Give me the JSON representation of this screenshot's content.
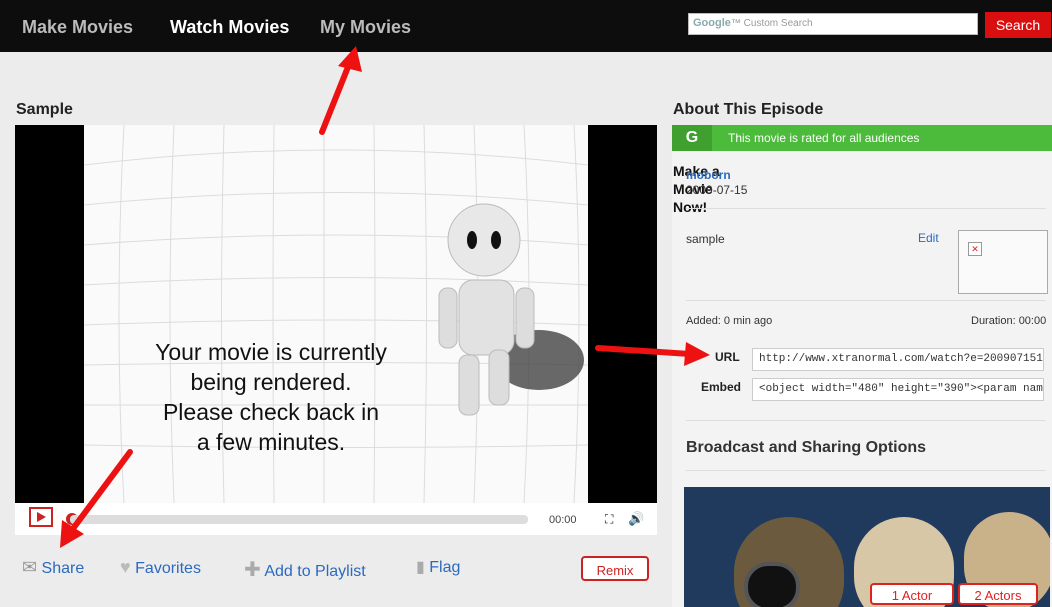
{
  "nav": {
    "items": [
      {
        "label": "Make Movies",
        "color": "#bbbbbb"
      },
      {
        "label": "Watch Movies",
        "color": "#ffffff"
      },
      {
        "label": "My Movies",
        "color": "#bbbbbb"
      }
    ]
  },
  "search": {
    "brand": "Google",
    "placeholder": "Custom Search",
    "button": "Search"
  },
  "video": {
    "title": "Sample",
    "message": [
      "Your movie is currently",
      "being rendered.",
      "Please check back in",
      "a few minutes."
    ],
    "time": "00:00"
  },
  "actions": {
    "share": "Share",
    "favorites": "Favorites",
    "playlist": "Add to Playlist",
    "flag": "Flag",
    "remix": "Remix"
  },
  "episode": {
    "heading": "About This Episode",
    "rating_letter": "G",
    "rating_text": "This movie is rated for all audiences",
    "overlay": "Make a Movie Now!",
    "author": "moborn",
    "date": "2009-07-15",
    "description": "sample",
    "edit": "Edit",
    "added": "Added: 0 min ago",
    "duration": "Duration: 00:00",
    "url_label": "URL",
    "url_value": "http://www.xtranormal.com/watch?e=200907151",
    "embed_label": "Embed",
    "embed_value": "<object width=\"480\" height=\"390\"><param nam"
  },
  "broadcast": {
    "heading": "Broadcast and Sharing Options"
  },
  "actors": {
    "one": "1 Actor",
    "two": "2 Actors"
  },
  "colors": {
    "accent_red": "#d90f0f",
    "rating_green": "#4cba3a",
    "link_blue": "#2a6abf"
  }
}
